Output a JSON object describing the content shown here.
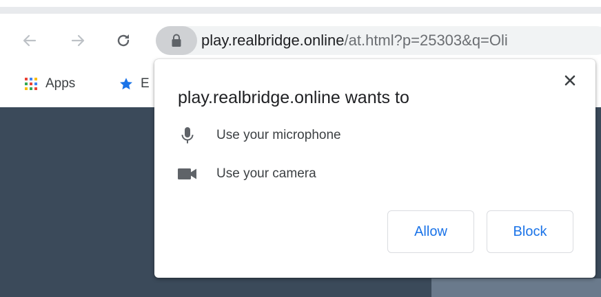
{
  "toolbar": {
    "back_icon": "arrow-left-icon",
    "forward_icon": "arrow-right-icon",
    "reload_icon": "reload-icon",
    "lock_icon": "lock-icon"
  },
  "omnibox": {
    "host": "play.realbridge.online",
    "path": "/at.html?p=25303&q=Oli"
  },
  "bookmarks": {
    "items": [
      {
        "label": "Apps",
        "icon": "apps-grid-icon"
      },
      {
        "label": "E",
        "icon": "star-icon"
      }
    ]
  },
  "permission_prompt": {
    "title": "play.realbridge.online wants to",
    "permissions": [
      {
        "label": "Use your microphone",
        "icon": "microphone-icon"
      },
      {
        "label": "Use your camera",
        "icon": "camera-icon"
      }
    ],
    "allow_label": "Allow",
    "block_label": "Block",
    "close_icon": "close-icon"
  },
  "colors": {
    "button_text": "#1a73e8",
    "page_background": "#3b4a5a",
    "omnibox_bg": "#f1f3f4",
    "lock_chip_bg": "#cfd1d4"
  }
}
